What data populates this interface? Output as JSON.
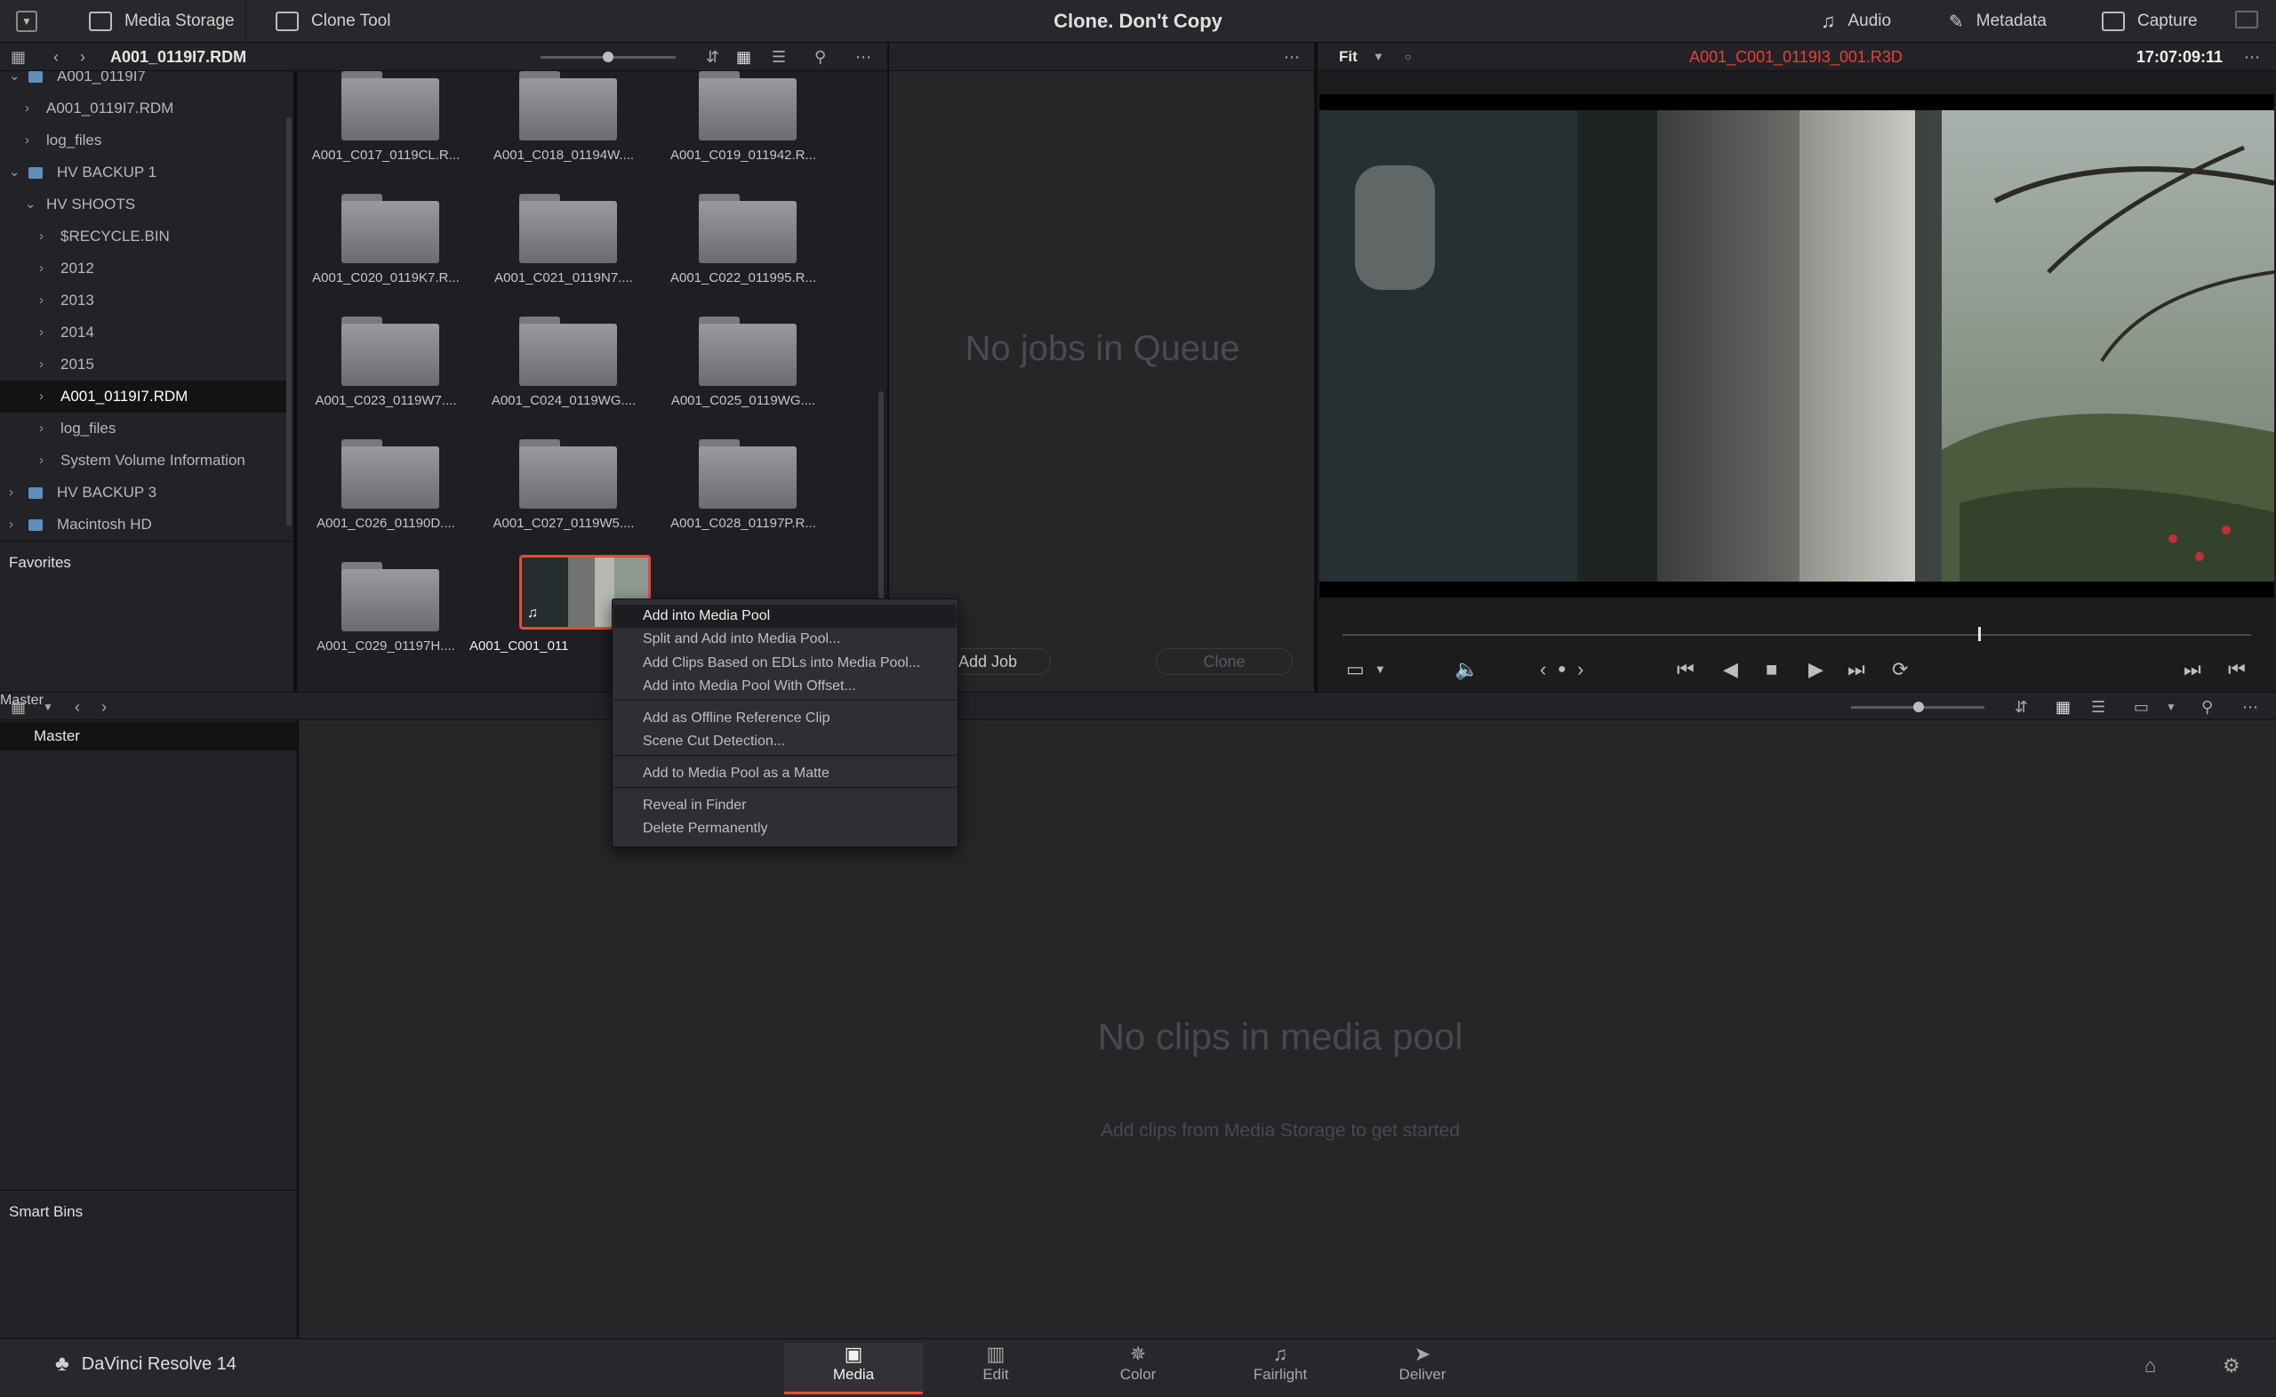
{
  "top_bar": {
    "media_storage": "Media Storage",
    "clone_tool": "Clone Tool",
    "title": "Clone. Don't Copy",
    "audio": "Audio",
    "metadata": "Metadata",
    "capture": "Capture"
  },
  "storage": {
    "path": "A001_0119I7.RDM",
    "tree": [
      {
        "label": "A001_0119I7",
        "indent": 1,
        "chev": "v",
        "drive": true
      },
      {
        "label": "A001_0119I7.RDM",
        "indent": 2,
        "chev": ">"
      },
      {
        "label": "log_files",
        "indent": 2,
        "chev": ">"
      },
      {
        "label": "HV BACKUP 1",
        "indent": 1,
        "chev": "v",
        "drive": true
      },
      {
        "label": "HV SHOOTS",
        "indent": 2,
        "chev": "v"
      },
      {
        "label": "$RECYCLE.BIN",
        "indent": 3,
        "chev": ">"
      },
      {
        "label": "2012",
        "indent": 3,
        "chev": ">"
      },
      {
        "label": "2013",
        "indent": 3,
        "chev": ">"
      },
      {
        "label": "2014",
        "indent": 3,
        "chev": ">"
      },
      {
        "label": "2015",
        "indent": 3,
        "chev": ">"
      },
      {
        "label": "A001_0119I7.RDM",
        "indent": 3,
        "chev": ">",
        "selected": true
      },
      {
        "label": "log_files",
        "indent": 3,
        "chev": ">"
      },
      {
        "label": "System Volume Information",
        "indent": 3,
        "chev": ">"
      },
      {
        "label": "HV BACKUP 3",
        "indent": 1,
        "chev": ">",
        "drive": true
      },
      {
        "label": "Macintosh HD",
        "indent": 1,
        "chev": ">",
        "drive": true
      }
    ],
    "favorites": "Favorites",
    "clips": [
      "A001_C017_0119CL.R...",
      "A001_C018_01194W....",
      "A001_C019_011942.R...",
      "A001_C020_0119K7.R...",
      "A001_C021_0119N7....",
      "A001_C022_011995.R...",
      "A001_C023_0119W7....",
      "A001_C024_0119WG....",
      "A001_C025_0119WG....",
      "A001_C026_01190D....",
      "A001_C027_0119W5....",
      "A001_C028_01197P.R...",
      "A001_C029_01197H...."
    ],
    "selected_clip": "A001_C001_011"
  },
  "clone": {
    "empty": "No jobs in Queue",
    "add_job": "Add Job",
    "clone_btn": "Clone"
  },
  "viewer": {
    "zoom": "Fit",
    "clip_name": "A001_C001_0119I3_001.R3D",
    "timecode": "17:07:09:11",
    "playhead_fraction": 0.7
  },
  "context_menu": {
    "items": [
      "Add into Media Pool",
      "Split and Add into Media Pool...",
      "Add Clips Based on EDLs into Media Pool...",
      "Add into Media Pool With Offset...",
      "Add as Offline Reference Clip",
      "Scene Cut Detection...",
      "Add to Media Pool as a Matte",
      "Reveal in Finder",
      "Delete Permanently"
    ]
  },
  "media_pool": {
    "breadcrumb": "Master",
    "bin": "Master",
    "smart_bins": "Smart Bins",
    "empty": "No clips in media pool",
    "empty_sub": "Add clips from Media Storage to get started"
  },
  "footer": {
    "brand": "DaVinci Resolve 14",
    "pages": [
      {
        "label": "Media",
        "icon": "media-icon",
        "active": true
      },
      {
        "label": "Edit",
        "icon": "edit-icon"
      },
      {
        "label": "Color",
        "icon": "color-icon"
      },
      {
        "label": "Fairlight",
        "icon": "fairlight-icon"
      },
      {
        "label": "Deliver",
        "icon": "deliver-icon"
      }
    ]
  },
  "colors": {
    "accent": "#e44b3c",
    "clip_name": "#e8403a"
  }
}
